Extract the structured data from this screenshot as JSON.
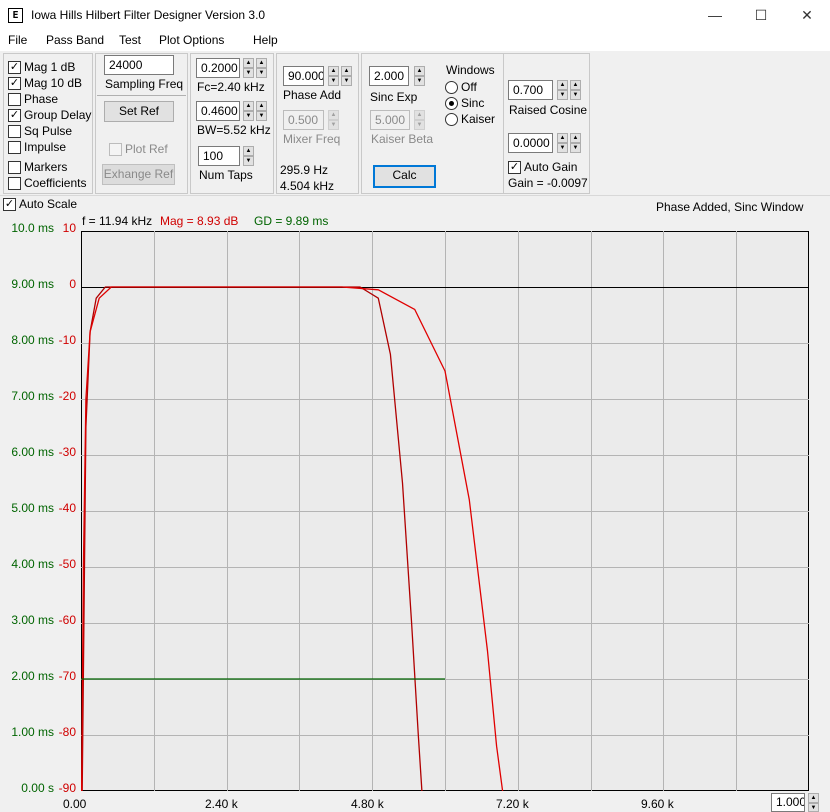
{
  "window": {
    "title": "Iowa Hills Hilbert Filter Designer  Version 3.0",
    "icon_glyph": "E",
    "minimize_glyph": "—",
    "maximize_glyph": "☐",
    "close_glyph": "✕"
  },
  "menu": [
    "File",
    "Pass Band",
    "Test",
    "Plot Options",
    "Help"
  ],
  "display_options": [
    {
      "label": "Mag   1 dB",
      "checked": true
    },
    {
      "label": "Mag 10 dB",
      "checked": true
    },
    {
      "label": "Phase",
      "checked": false
    },
    {
      "label": "Group Delay",
      "checked": true
    },
    {
      "label": "Sq Pulse",
      "checked": false
    },
    {
      "label": "Impulse",
      "checked": false
    },
    {
      "label": "Markers",
      "checked": false
    },
    {
      "label": "Coefficients",
      "checked": false
    }
  ],
  "sampling": {
    "value": "24000",
    "label": "Sampling Freq"
  },
  "buttons": {
    "set_ref": "Set Ref",
    "plot_ref": "Plot Ref",
    "exchange_ref": "Exhange Ref",
    "calc": "Calc"
  },
  "fc": {
    "value": "0.2000",
    "label": "Fc=2.40 kHz"
  },
  "bw": {
    "value": "0.4600",
    "label": "BW=5.52 kHz"
  },
  "num_taps": {
    "value": "100",
    "label": "Num Taps"
  },
  "phase_add": {
    "value": "90.000",
    "label": "Phase Add"
  },
  "mixer": {
    "value": "0.500",
    "label": "Mixer Freq"
  },
  "freq_info": {
    "line1": "295.9 Hz",
    "line2": "4.504 kHz"
  },
  "sinc_exp": {
    "value": "2.000",
    "label": "Sinc Exp"
  },
  "kaiser_beta": {
    "value": "5.000",
    "label": "Kaiser Beta"
  },
  "windows": {
    "title": "Windows",
    "options": [
      {
        "label": "Off",
        "selected": false
      },
      {
        "label": "Sinc",
        "selected": true
      },
      {
        "label": "Kaiser",
        "selected": false
      }
    ]
  },
  "raised_cosine": {
    "value": "0.700",
    "label": "Raised Cosine"
  },
  "gain": {
    "value": "0.0000",
    "auto_label": "Auto Gain",
    "auto_checked": true,
    "gain_text": "Gain = -0.0097"
  },
  "plot": {
    "auto_scale_label": "Auto Scale",
    "auto_scale_checked": true,
    "status": "Phase Added, Sinc Window",
    "readout": {
      "f": "f = 11.94 kHz",
      "mag": "Mag = 8.93 dB",
      "gd": "GD = 9.89 ms"
    },
    "zoom_value": "1.000",
    "colors": {
      "mag": "#e00000",
      "mag10": "#b00000",
      "gd": "#006400",
      "grid": "#b4b4b4",
      "ref": "#000000"
    }
  },
  "chart_data": {
    "type": "line",
    "x_tick_labels": [
      "0.00",
      "2.40 k",
      "4.80 k",
      "7.20 k",
      "9.60 k"
    ],
    "x_ticks": [
      0,
      2.4,
      4.8,
      7.2,
      9.6
    ],
    "xlim": [
      0,
      12
    ],
    "x_unit": "kHz",
    "y_left_tick_labels": [
      "10.0 ms",
      "9.00 ms",
      "8.00 ms",
      "7.00 ms",
      "6.00 ms",
      "5.00 ms",
      "4.00 ms",
      "3.00 ms",
      "2.00 ms",
      "1.00 ms",
      "0.00 s"
    ],
    "y_right_tick_labels": [
      "10",
      "0",
      "-10",
      "-20",
      "-30",
      "-40",
      "-50",
      "-60",
      "-70",
      "-80",
      "-90"
    ],
    "ylim_ms": [
      0,
      10
    ],
    "ylim_db": [
      -90,
      10
    ],
    "reference_line_db": 0,
    "series": [
      {
        "name": "Mag 10 dB",
        "x": [
          0.02,
          0.08,
          0.15,
          0.25,
          0.4,
          0.8,
          2.4,
          4.6,
          4.9,
          5.1,
          5.3,
          5.45,
          5.56,
          5.62
        ],
        "y": [
          -90,
          -25,
          -8,
          -2,
          0,
          0,
          0,
          0,
          -2,
          -12,
          -35,
          -60,
          -80,
          -90
        ]
      },
      {
        "name": "Mag 1 dB",
        "x": [
          0.01,
          0.04,
          0.08,
          0.15,
          0.3,
          0.5,
          2.4,
          4.3,
          4.9,
          5.5,
          6.0,
          6.4,
          6.7,
          6.85,
          6.95
        ],
        "y": [
          -90,
          -50,
          -20,
          -8,
          -2,
          0,
          0,
          0,
          -0.5,
          -4,
          -15,
          -38,
          -65,
          -82,
          -90
        ]
      },
      {
        "name": "Group Delay",
        "x": [
          0.0,
          6.0
        ],
        "y": [
          2.0,
          2.0
        ],
        "unit": "ms"
      }
    ]
  }
}
